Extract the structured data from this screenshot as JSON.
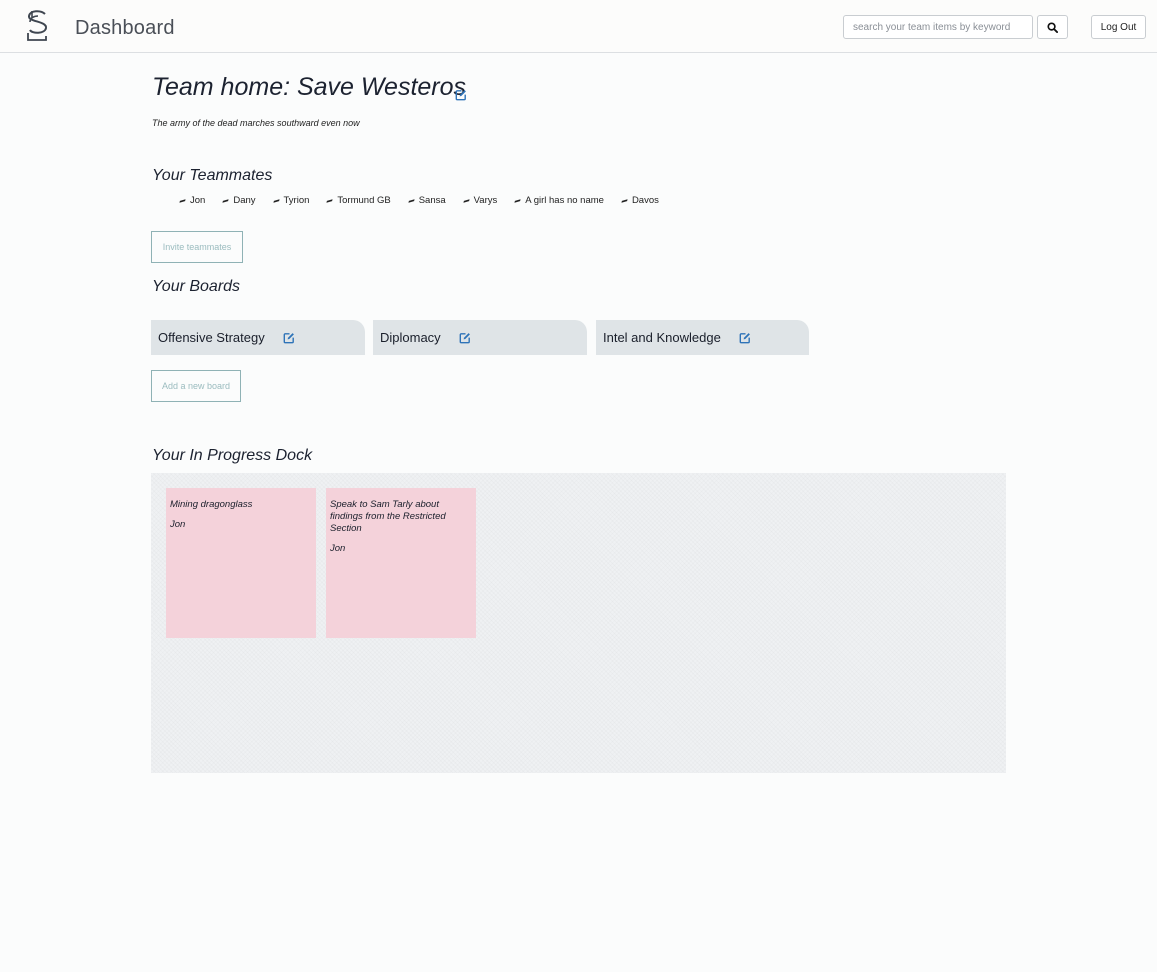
{
  "header": {
    "app_title": "Dashboard",
    "search_placeholder": "search your team items by keyword",
    "search_icon": "search-icon",
    "logout_label": "Log Out"
  },
  "team": {
    "title": "Team home: Save Westeros",
    "description": "The army of the dead marches southward even now"
  },
  "teammates": {
    "heading": "Your Teammates",
    "names": [
      "Jon",
      "Dany",
      "Tyrion",
      "Tormund GB",
      "Sansa",
      "Varys",
      "A girl has no name",
      "Davos"
    ],
    "invite_label": "Invite teammates"
  },
  "boards": {
    "heading": "Your Boards",
    "items": [
      {
        "label": "Offensive Strategy"
      },
      {
        "label": "Diplomacy"
      },
      {
        "label": "Intel and Knowledge"
      }
    ],
    "add_label": "Add a new board"
  },
  "dock": {
    "heading": "Your In Progress Dock",
    "cards": [
      {
        "text": "Mining dragonglass",
        "owner": "Jon"
      },
      {
        "text": "Speak to Sam Tarly about findings from the Restricted Section",
        "owner": "Jon"
      }
    ]
  },
  "colors": {
    "accent": "#2e73b8",
    "board_tab": "#dfe4e7",
    "card": "#f4d2da",
    "outline_button": "#8fb2b5"
  }
}
